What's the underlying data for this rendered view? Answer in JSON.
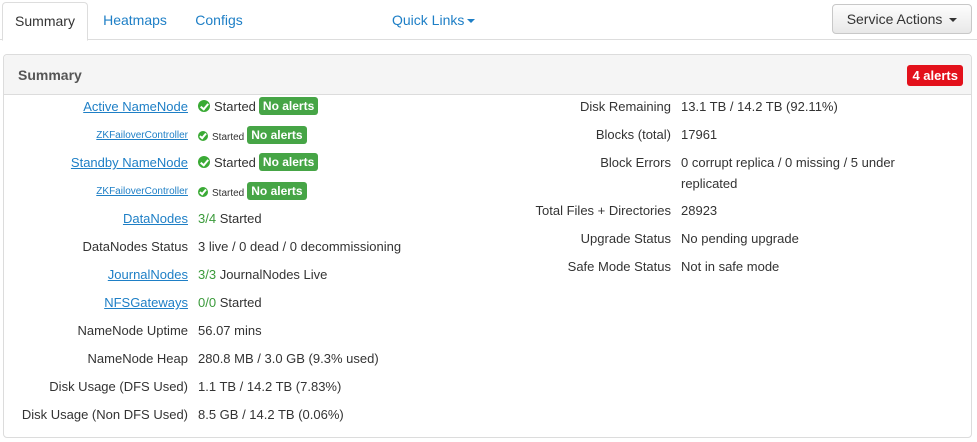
{
  "tabs": [
    {
      "label": "Summary"
    },
    {
      "label": "Heatmaps"
    },
    {
      "label": "Configs"
    }
  ],
  "quick_links": "Quick Links",
  "service_actions": "Service Actions",
  "panel": {
    "title": "Summary",
    "alerts": "4 alerts"
  },
  "left": {
    "active_namenode": {
      "label": "Active NameNode",
      "status": "Started",
      "badge": "No alerts"
    },
    "zkfc1": {
      "label": "ZKFailoverController",
      "status": "Started",
      "badge": "No alerts"
    },
    "standby_namenode": {
      "label": "Standby NameNode",
      "status": "Started",
      "badge": "No alerts"
    },
    "zkfc2": {
      "label": "ZKFailoverController",
      "status": "Started",
      "badge": "No alerts"
    },
    "datanodes": {
      "label": "DataNodes",
      "count": "3/4",
      "suffix": "Started"
    },
    "datanodes_status": {
      "label": "DataNodes Status",
      "value": "3 live / 0 dead / 0 decommissioning"
    },
    "journalnodes": {
      "label": "JournalNodes",
      "count": "3/3",
      "suffix": "JournalNodes Live"
    },
    "nfsgateways": {
      "label": "NFSGateways",
      "count": "0/0",
      "suffix": "Started"
    },
    "namenode_uptime": {
      "label": "NameNode Uptime",
      "value": "56.07 mins"
    },
    "namenode_heap": {
      "label": "NameNode Heap",
      "value": "280.8 MB / 3.0 GB (9.3% used)"
    },
    "disk_usage_dfs": {
      "label": "Disk Usage (DFS Used)",
      "value": "1.1 TB / 14.2 TB (7.83%)"
    },
    "disk_usage_non_dfs": {
      "label": "Disk Usage (Non DFS Used)",
      "value": "8.5 GB / 14.2 TB (0.06%)"
    }
  },
  "right": {
    "disk_remaining": {
      "label": "Disk Remaining",
      "value": "13.1 TB / 14.2 TB (92.11%)"
    },
    "blocks_total": {
      "label": "Blocks (total)",
      "value": "17961"
    },
    "block_errors": {
      "label": "Block Errors",
      "value_line1": "0 corrupt replica / 0 missing / 5 under",
      "value_line2": "replicated"
    },
    "total_files": {
      "label": "Total Files + Directories",
      "value": "28923"
    },
    "upgrade_status": {
      "label": "Upgrade Status",
      "value": "No pending upgrade"
    },
    "safe_mode": {
      "label": "Safe Mode Status",
      "value": "Not in safe mode"
    }
  }
}
